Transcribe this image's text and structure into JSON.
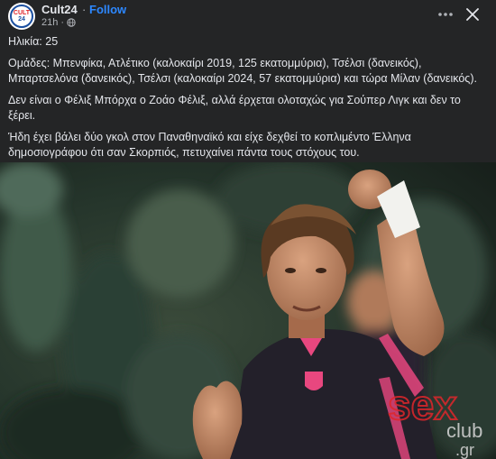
{
  "header": {
    "avatar_top": "CULT",
    "avatar_bottom": "24",
    "page_name": "Cult24",
    "separator": "·",
    "follow_label": "Follow",
    "timestamp": "21h",
    "timestamp_separator": "·",
    "privacy_icon": "globe-icon",
    "more_icon": "more-dots-icon",
    "close_icon": "close-icon"
  },
  "post": {
    "paragraphs": [
      "Ηλικία: 25",
      "Ομάδες: Μπενφίκα, Ατλέτικο (καλοκαίρι 2019, 125 εκατομμύρια), Τσέλσι (δανεικός), Μπαρτσελόνα (δανεικός), Τσέλσι (καλοκαίρι 2024, 57 εκατομμύρια) και τώρα Μίλαν (δανεικός).",
      "Δεν είναι ο Φέλιξ Μπόρχα ο Ζοάο Φέλιξ, αλλά έρχεται ολοταχώς για Σούπερ Λιγκ και δεν το ξέρει.",
      "Ήδη έχει βάλει δύο γκολ στον Παναθηναϊκό και είχε δεχθεί το κοπλιμέντο Έλληνα δημοσιογράφου ότι σαν Σκορπιός, πετυχαίνει πάντα τους στόχους του."
    ]
  },
  "photo": {
    "watermark_brand": "sex",
    "watermark_sub": "club",
    "watermark_domain": ".gr",
    "colors": {
      "background": "#242526",
      "text": "#e4e6eb",
      "muted": "#b0b3b8",
      "follow": "#2d88ff",
      "kit_pink": "#e8477f",
      "watermark_red": "#e0262b"
    }
  }
}
